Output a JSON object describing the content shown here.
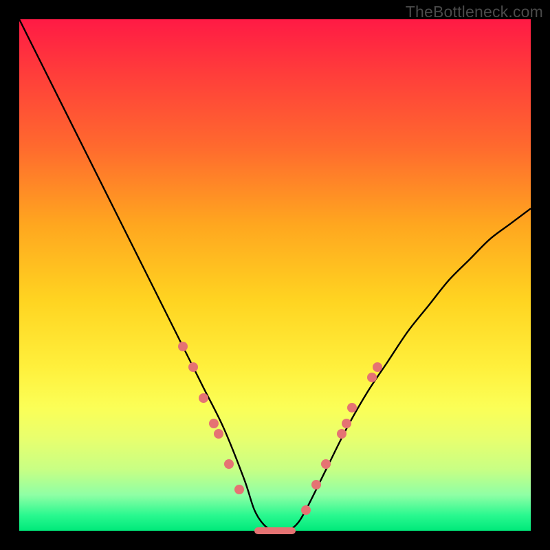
{
  "watermark": "TheBottleneck.com",
  "colors": {
    "frame": "#000000",
    "curve": "#000000",
    "marker": "#e57373",
    "gradient_stops": [
      "#ff1a45",
      "#ff3b3b",
      "#ff6a2e",
      "#ffa61f",
      "#ffd421",
      "#fff03c",
      "#fbff57",
      "#e8ff6e",
      "#c8ff84",
      "#8fffa5",
      "#29f88f",
      "#00e97a"
    ]
  },
  "chart_data": {
    "type": "line",
    "title": "",
    "xlabel": "",
    "ylabel": "",
    "xlim": [
      0,
      100
    ],
    "ylim": [
      0,
      100
    ],
    "grid": false,
    "series": [
      {
        "name": "bottleneck-curve",
        "x": [
          0,
          4,
          8,
          12,
          16,
          20,
          24,
          28,
          32,
          36,
          40,
          44,
          46,
          48,
          50,
          52,
          54,
          56,
          60,
          64,
          68,
          72,
          76,
          80,
          84,
          88,
          92,
          96,
          100
        ],
        "y": [
          100,
          92,
          84,
          76,
          68,
          60,
          52,
          44,
          36,
          28,
          20,
          10,
          4,
          1,
          0,
          0,
          1,
          4,
          12,
          20,
          27,
          33,
          39,
          44,
          49,
          53,
          57,
          60,
          63
        ]
      }
    ],
    "markers_left": [
      {
        "x": 32,
        "y": 36
      },
      {
        "x": 34,
        "y": 32
      },
      {
        "x": 36,
        "y": 26
      },
      {
        "x": 38,
        "y": 21
      },
      {
        "x": 39,
        "y": 19
      },
      {
        "x": 41,
        "y": 13
      },
      {
        "x": 43,
        "y": 8
      }
    ],
    "markers_right": [
      {
        "x": 56,
        "y": 4
      },
      {
        "x": 58,
        "y": 9
      },
      {
        "x": 60,
        "y": 13
      },
      {
        "x": 63,
        "y": 19
      },
      {
        "x": 64,
        "y": 21
      },
      {
        "x": 65,
        "y": 24
      },
      {
        "x": 69,
        "y": 30
      },
      {
        "x": 70,
        "y": 32
      }
    ],
    "bottom_bar": {
      "x_start": 46,
      "x_end": 54,
      "y": 0
    }
  }
}
